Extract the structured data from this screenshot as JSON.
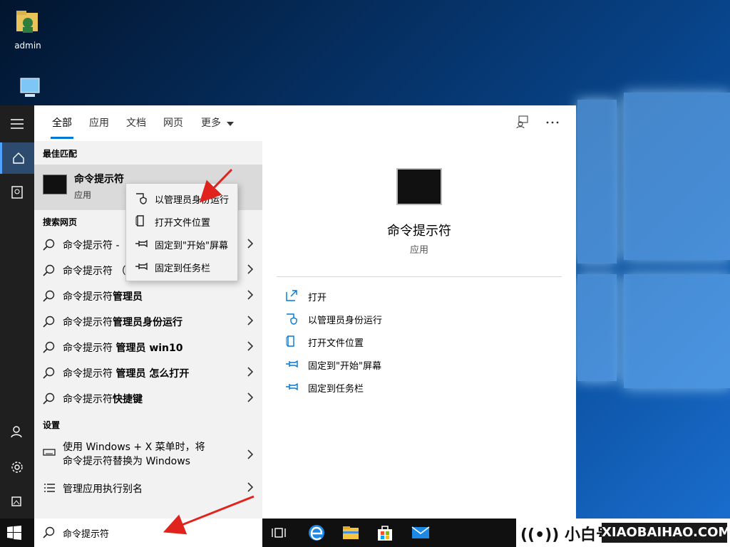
{
  "desktop": {
    "icons": [
      {
        "label": "admin",
        "icon": "user-folder-icon"
      },
      {
        "label": "",
        "icon": "this-pc-icon"
      }
    ]
  },
  "rail": {
    "items": [
      "hamburger-menu-icon",
      "home-icon",
      "documents-icon",
      "user-icon",
      "gear-icon",
      "photos-icon"
    ]
  },
  "tabs": {
    "all": "全部",
    "apps": "应用",
    "docs": "文档",
    "web": "网页",
    "more": "更多"
  },
  "results": {
    "best_match_label": "最佳匹配",
    "best": {
      "title": "命令提示符",
      "type": "应用"
    },
    "web_label": "搜索网页",
    "web_items": [
      {
        "base": "命令提示符 - ",
        "bold": ""
      },
      {
        "base": "命令提示符 （",
        "bold": ""
      },
      {
        "base": "命令提示符",
        "bold": "管理员"
      },
      {
        "base": "命令提示符",
        "bold": "管理员身份运行"
      },
      {
        "base": "命令提示符 ",
        "bold": "管理员 win10"
      },
      {
        "base": "命令提示符 ",
        "bold": "管理员 怎么打开"
      },
      {
        "base": "命令提示符",
        "bold": "快捷键"
      }
    ],
    "settings_label": "设置",
    "settings_items": [
      {
        "line1": "使用 Windows + X 菜单时，将",
        "line2": "命令提示符替换为 Windows"
      },
      {
        "line1": "管理应用执行别名",
        "line2": ""
      }
    ]
  },
  "context_menu": [
    "以管理员身份运行",
    "打开文件位置",
    "固定到\"开始\"屏幕",
    "固定到任务栏"
  ],
  "preview": {
    "name": "命令提示符",
    "type": "应用",
    "actions": [
      "打开",
      "以管理员身份运行",
      "打开文件位置",
      "固定到\"开始\"屏幕",
      "固定到任务栏"
    ]
  },
  "taskbar": {
    "search_value": "命令提示符",
    "apps": [
      "task-view-icon",
      "edge-icon",
      "file-explorer-icon",
      "store-icon",
      "mail-icon"
    ]
  },
  "watermark": {
    "left": "((•)) 小白号",
    "right": "XIAOBAIHAO.COM"
  },
  "colors": {
    "accent": "#0078d4",
    "rail": "#1f1f1f",
    "arrow": "#e0231c"
  }
}
